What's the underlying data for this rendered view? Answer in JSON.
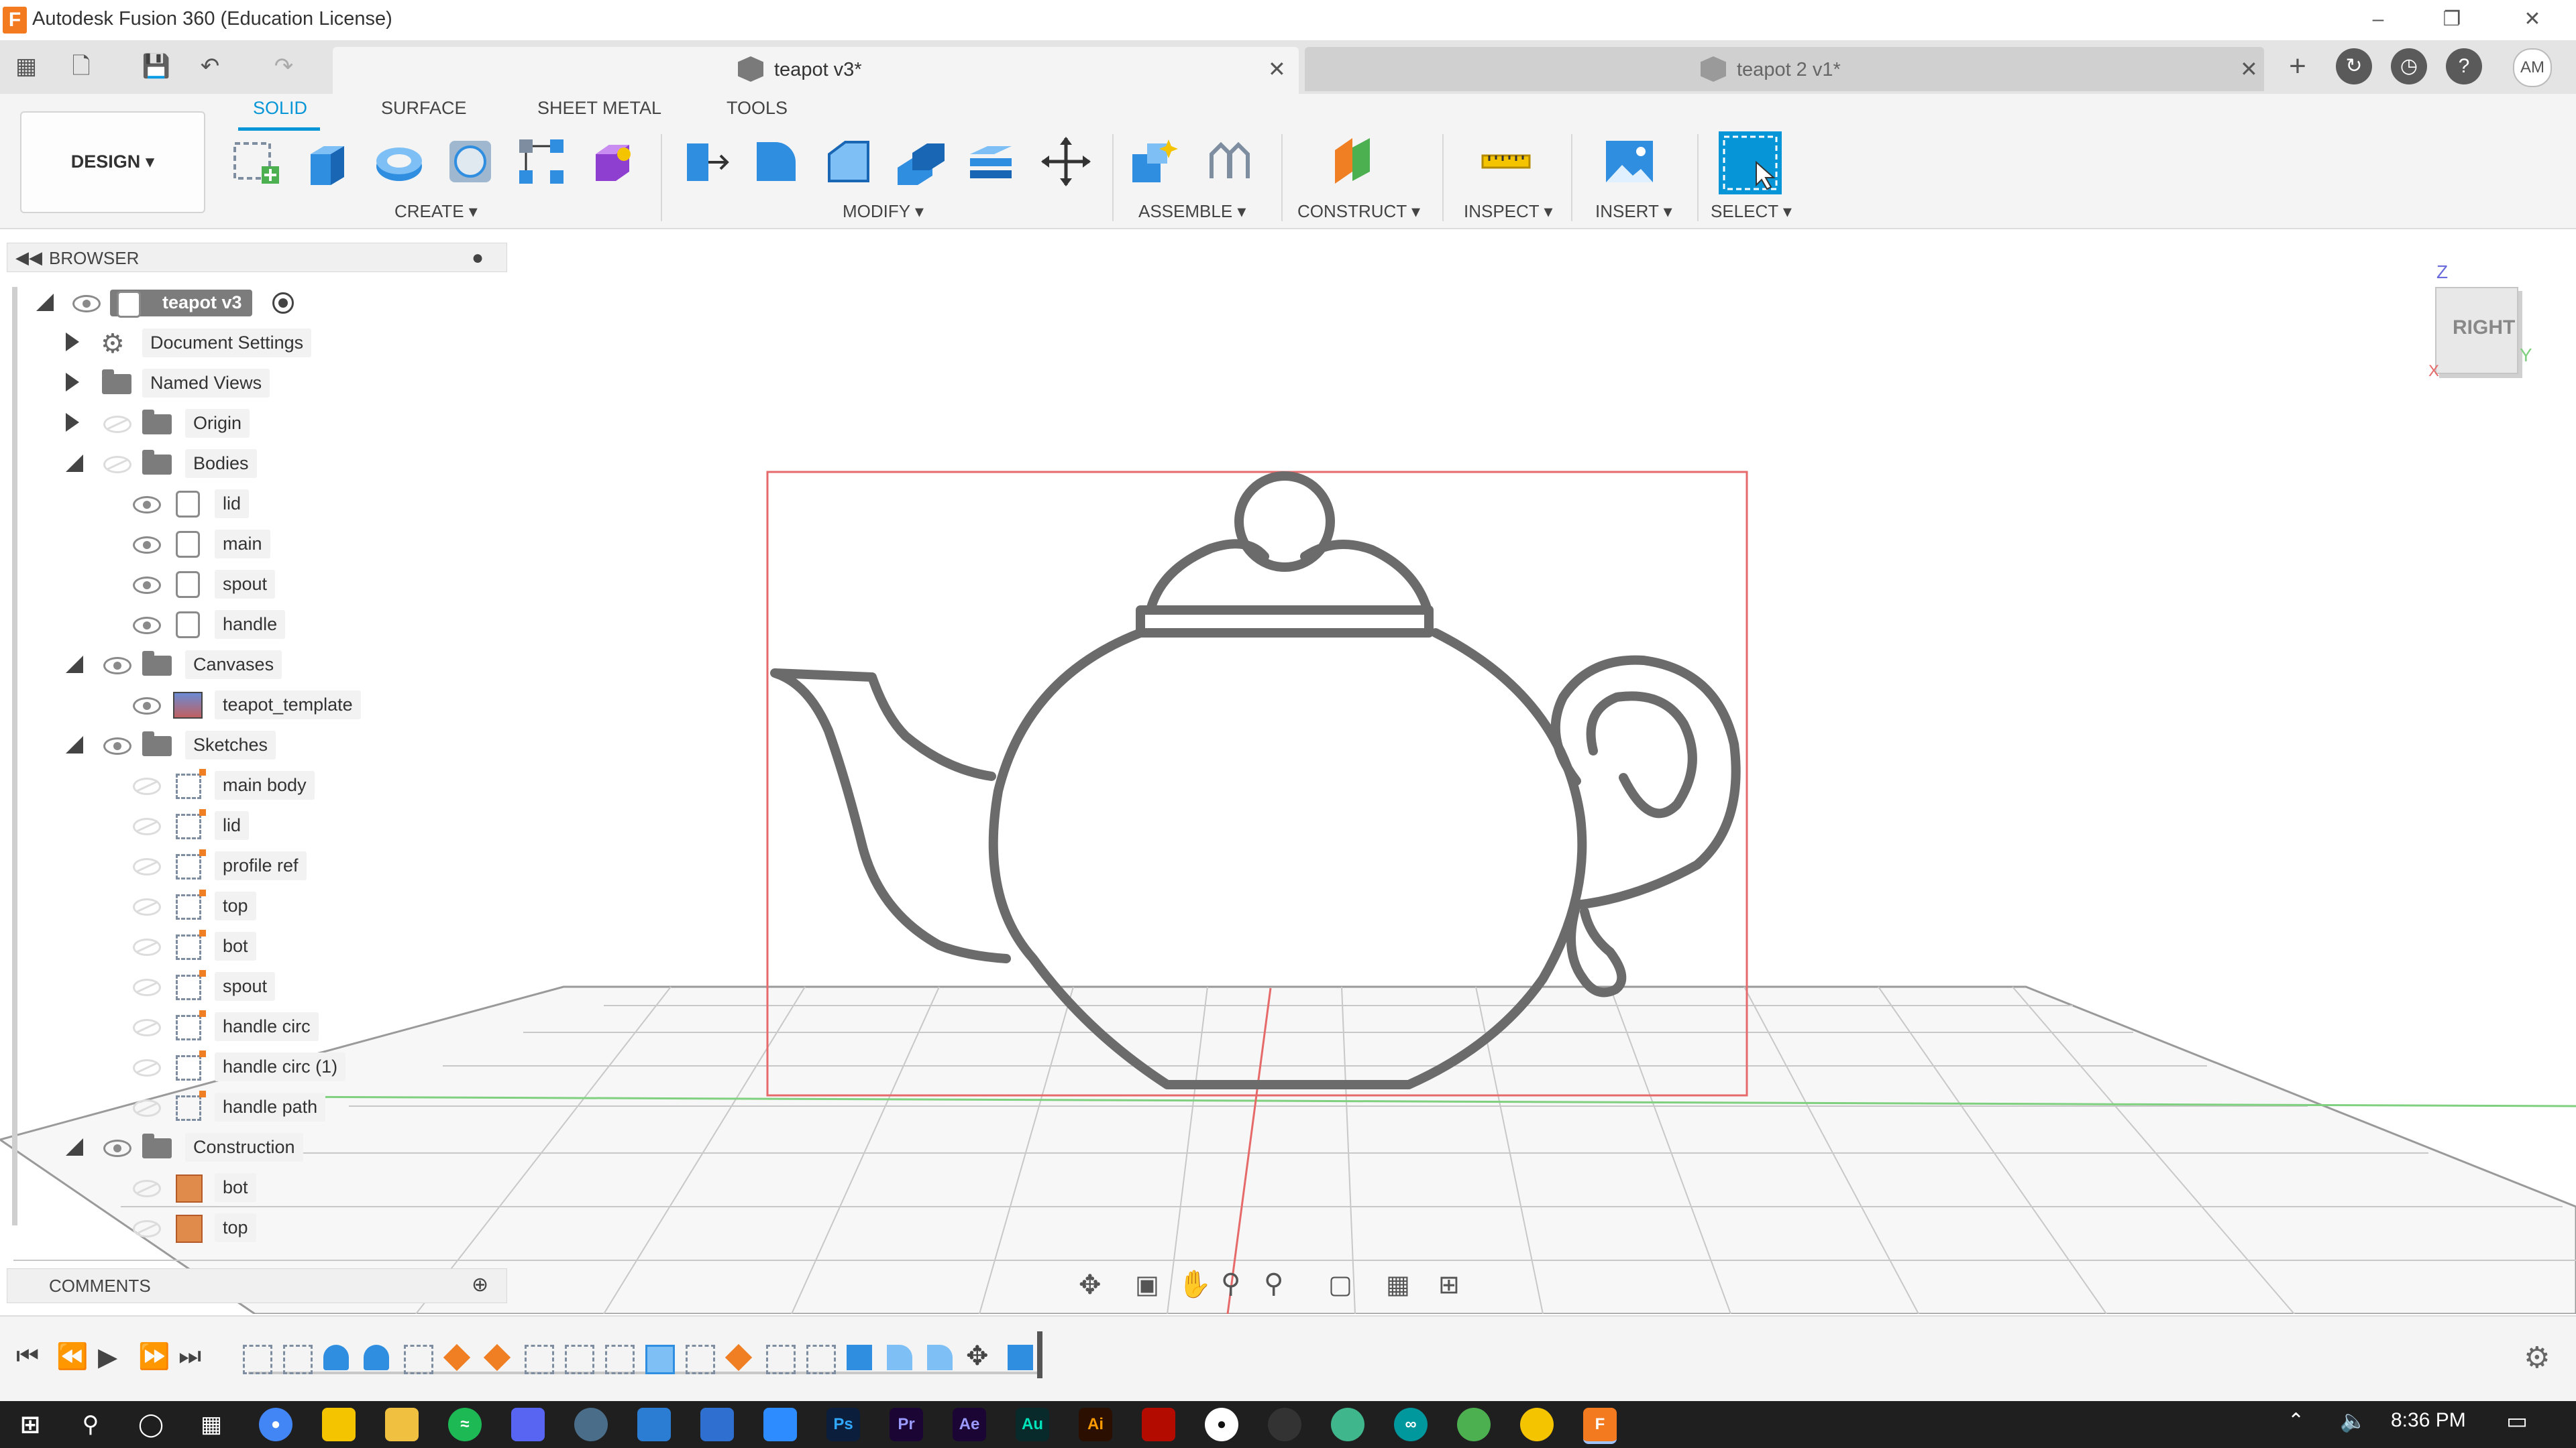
{
  "window": {
    "title": "Autodesk Fusion 360 (Education License)",
    "app_icon": "F"
  },
  "tabs": [
    {
      "label": "teapot v3*",
      "active": true
    },
    {
      "label": "teapot 2 v1*",
      "active": false
    }
  ],
  "user": {
    "initials": "AM"
  },
  "workspace": {
    "label": "DESIGN"
  },
  "toolbar_tabs": [
    "SOLID",
    "SURFACE",
    "SHEET METAL",
    "TOOLS"
  ],
  "groups": {
    "create": "CREATE",
    "modify": "MODIFY",
    "assemble": "ASSEMBLE",
    "construct": "CONSTRUCT",
    "inspect": "INSPECT",
    "insert": "INSERT",
    "select": "SELECT"
  },
  "browser": {
    "title": "BROWSER",
    "root": "teapot v3",
    "items": [
      {
        "label": "Document Settings"
      },
      {
        "label": "Named Views"
      },
      {
        "label": "Origin"
      },
      {
        "label": "Bodies"
      },
      {
        "label": "lid"
      },
      {
        "label": "main"
      },
      {
        "label": "spout"
      },
      {
        "label": "handle"
      },
      {
        "label": "Canvases"
      },
      {
        "label": "teapot_template"
      },
      {
        "label": "Sketches"
      },
      {
        "label": "main body"
      },
      {
        "label": "lid"
      },
      {
        "label": "profile ref"
      },
      {
        "label": "top"
      },
      {
        "label": "bot"
      },
      {
        "label": "spout"
      },
      {
        "label": "handle circ"
      },
      {
        "label": "handle circ (1)"
      },
      {
        "label": "handle path"
      },
      {
        "label": "Construction"
      },
      {
        "label": "bot"
      },
      {
        "label": "top"
      }
    ]
  },
  "comments": {
    "title": "COMMENTS"
  },
  "viewcube": {
    "face": "RIGHT",
    "axis_z": "Z",
    "axis_y": "Y",
    "axis_x": "X"
  },
  "taskbar": {
    "time": "8:36 PM"
  },
  "colors": {
    "accent": "#0696d7",
    "sketch_frame": "#e66a6a",
    "teapot_stroke": "#6b6b6b"
  }
}
